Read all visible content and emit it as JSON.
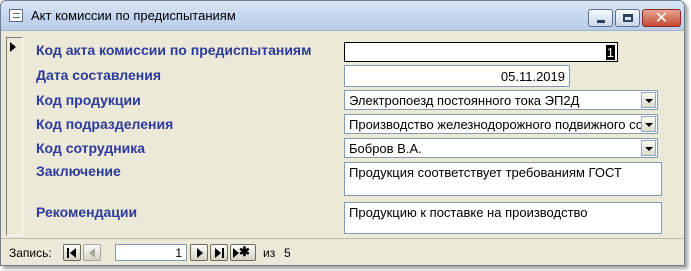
{
  "window": {
    "title": "Акт комиссии по предиспытаниям",
    "close_glyph": "✕"
  },
  "form": {
    "fields": [
      {
        "label": "Код акта комиссии по предиспытаниям",
        "value": "1"
      },
      {
        "label": "Дата составления",
        "value": "05.11.2019"
      },
      {
        "label": "Код продукции",
        "value": "Электропоезд постоянного тока ЭП2Д"
      },
      {
        "label": "Код подразделения",
        "value": "Производство железнодорожного подвижного со"
      },
      {
        "label": "Код сотрудника",
        "value": "Бобров В.А."
      },
      {
        "label": "Заключение",
        "value": "Продукция соответствует требованиям ГОСТ"
      },
      {
        "label": "Рекомендации",
        "value": "Продукцию к поставке на производство"
      }
    ]
  },
  "navigation": {
    "record_label": "Запись:",
    "current_record": "1",
    "of_label": "из",
    "total_records": "5",
    "new_record_glyph": "✱"
  },
  "colors": {
    "label_color": "#2a3b9b",
    "window_bg": "#ece9d8",
    "close_button": "#c64a33"
  }
}
